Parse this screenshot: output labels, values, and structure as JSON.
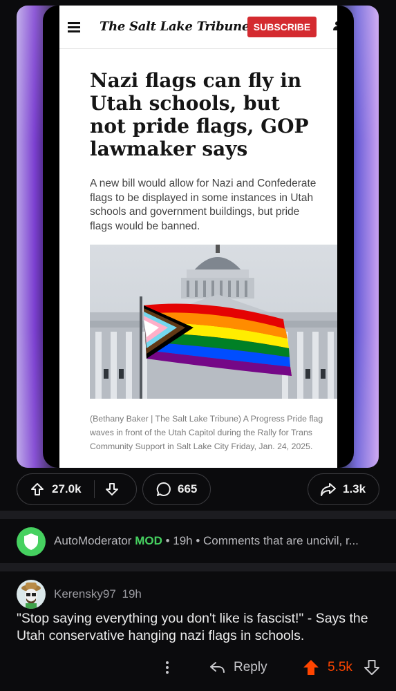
{
  "article": {
    "masthead": "The Salt Lake Tribune",
    "subscribe_label": "SUBSCRIBE",
    "headline": "Nazi flags can fly in Utah schools, but not pride flags, GOP lawmaker says",
    "dek": "A new bill would allow for Nazi and Confederate flags to be displayed in some instances in Utah schools and government buildings, but pride flags would be banned.",
    "caption": "(Bethany Baker | The Salt Lake Tribune) A Progress Pride flag waves in front of the Utah Capitol during the Rally for Trans Community Support in Salt Lake City Friday, Jan. 24, 2025."
  },
  "post_actions": {
    "upvotes": "27.0k",
    "comments": "665",
    "shares": "1.3k"
  },
  "automod": {
    "username": "AutoModerator",
    "mod_badge": "MOD",
    "meta": "• 19h • Comments that are uncivil, r..."
  },
  "comment": {
    "username": "Kerensky97",
    "age": "19h",
    "body": "\"Stop saying everything you don't like is fascist!\" - Says the Utah conservative hanging nazi flags in schools.",
    "reply_label": "Reply",
    "score": "5.5k"
  },
  "colors": {
    "accent_upvote": "#ff4500",
    "mod_green": "#46d160",
    "subscribe_red": "#d42b30"
  }
}
